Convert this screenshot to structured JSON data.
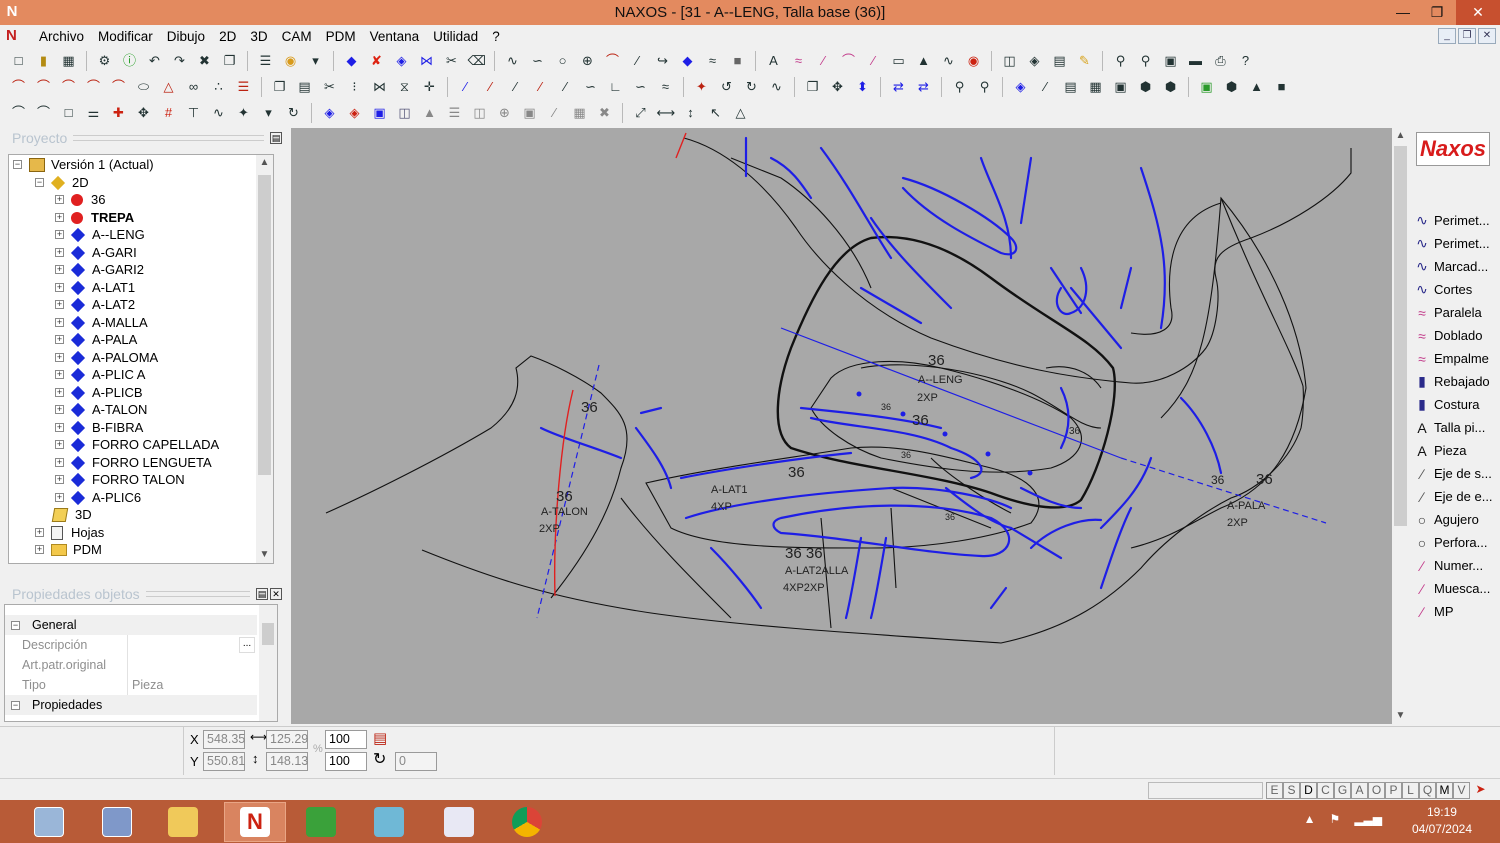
{
  "window": {
    "title": "NAXOS - [31 - A--LENG, Talla base (36)]",
    "app_icon": "N",
    "controls": [
      "minimize-icon",
      "restore-icon",
      "close-icon"
    ]
  },
  "menu": [
    "Archivo",
    "Modificar",
    "Dibujo",
    "2D",
    "3D",
    "CAM",
    "PDM",
    "Ventana",
    "Utilidad",
    "?"
  ],
  "project_panel": {
    "title": "Proyecto",
    "tree": {
      "root": "Versión 1 (Actual)",
      "group_2d": "2D",
      "items": [
        {
          "label": "36",
          "icon": "red-dot",
          "bold": false
        },
        {
          "label": "TREPA",
          "icon": "red-dot",
          "bold": true
        },
        {
          "label": "A--LENG",
          "icon": "blue-diamond",
          "bold": false
        },
        {
          "label": "A-GARI",
          "icon": "blue-diamond",
          "bold": false
        },
        {
          "label": "A-GARI2",
          "icon": "blue-diamond",
          "bold": false
        },
        {
          "label": "A-LAT1",
          "icon": "blue-diamond",
          "bold": false
        },
        {
          "label": "A-LAT2",
          "icon": "blue-diamond",
          "bold": false
        },
        {
          "label": "A-MALLA",
          "icon": "blue-diamond",
          "bold": false
        },
        {
          "label": "A-PALA",
          "icon": "blue-diamond",
          "bold": false
        },
        {
          "label": "A-PALOMA",
          "icon": "blue-diamond",
          "bold": false
        },
        {
          "label": "A-PLIC A",
          "icon": "blue-diamond",
          "bold": false
        },
        {
          "label": "A-PLICB",
          "icon": "blue-diamond",
          "bold": false
        },
        {
          "label": "A-TALON",
          "icon": "blue-diamond",
          "bold": false
        },
        {
          "label": "B-FIBRA",
          "icon": "blue-diamond",
          "bold": false
        },
        {
          "label": "FORRO CAPELLADA",
          "icon": "blue-diamond",
          "bold": false
        },
        {
          "label": "FORRO LENGUETA",
          "icon": "blue-diamond",
          "bold": false
        },
        {
          "label": "FORRO TALON",
          "icon": "blue-diamond",
          "bold": false
        },
        {
          "label": "A-PLIC6",
          "icon": "blue-diamond",
          "bold": false
        }
      ],
      "group_3d": "3D",
      "hojas": "Hojas",
      "pdm": "PDM"
    }
  },
  "properties_panel": {
    "title": "Propiedades objetos",
    "categories": [
      {
        "name": "General",
        "rows": [
          {
            "label": "Descripción",
            "value": "",
            "button": "..."
          },
          {
            "label": "Art.patr.original",
            "value": ""
          },
          {
            "label": "Tipo",
            "value": "Pieza"
          }
        ]
      },
      {
        "name": "Propiedades",
        "rows": []
      }
    ]
  },
  "canvas_labels": {
    "leng_size": "36",
    "leng_name": "A--LENG",
    "leng_qty": "2XP",
    "inner_size": "36",
    "talon_size_top": "36",
    "talon_size": "36",
    "talon_name": "A-TALON",
    "talon_qty": "2XP",
    "lat1_name": "A-LAT1",
    "lat1_qty": "4XP",
    "center_size": "36",
    "malla_sizes": "36 36",
    "malla_name": "A-LAT2ALLA",
    "malla_qty": "4XP2XP",
    "pala_size": "36",
    "pala_size_2": "36",
    "pala_name": "A-PALA",
    "pala_qty": "2XP",
    "right_size": "36",
    "small_size_1": "36",
    "small_size_2": "36",
    "small_size_3": "36"
  },
  "palette": {
    "logo": "Naxos",
    "items": [
      {
        "label": "Perimet...",
        "icon": "curve-icon"
      },
      {
        "label": "Perimet...",
        "icon": "curve-icon"
      },
      {
        "label": "Marcad...",
        "icon": "curve-icon"
      },
      {
        "label": "Cortes",
        "icon": "curve-icon"
      },
      {
        "label": "Paralela",
        "icon": "parallel-icon"
      },
      {
        "label": "Doblado",
        "icon": "fold-icon"
      },
      {
        "label": "Empalme",
        "icon": "join-icon"
      },
      {
        "label": "Rebajado",
        "icon": "skive-icon"
      },
      {
        "label": "Costura",
        "icon": "stitch-icon"
      },
      {
        "label": "Talla pi...",
        "icon": "text-A-icon"
      },
      {
        "label": "Pieza",
        "icon": "text-A-icon"
      },
      {
        "label": "Eje de s...",
        "icon": "axis-icon"
      },
      {
        "label": "Eje de e...",
        "icon": "axis-icon"
      },
      {
        "label": "Agujero",
        "icon": "circle-icon"
      },
      {
        "label": "Perfora...",
        "icon": "circle-icon"
      },
      {
        "label": "Numer...",
        "icon": "pen-icon"
      },
      {
        "label": "Muesca...",
        "icon": "pen-icon"
      },
      {
        "label": "MP",
        "icon": "pen-icon"
      }
    ]
  },
  "coords": {
    "x_label": "X",
    "y_label": "Y",
    "x": "548.35",
    "y": "550.81",
    "width": "125.29",
    "height": "148.13",
    "scale_x": "100",
    "scale_y": "100",
    "percent": "%",
    "angle": "0"
  },
  "status_flags": [
    "E",
    "S",
    "D",
    "C",
    "G",
    "A",
    "O",
    "P",
    "L",
    "Q",
    "M",
    "V"
  ],
  "taskbar": {
    "time": "19:19",
    "date": "04/07/2024"
  },
  "colors": {
    "titlebar": "#e38a5f",
    "canvas": "#a8a8a8",
    "piece_blue": "#1e1ee6",
    "taskbar": "#b85b37"
  }
}
